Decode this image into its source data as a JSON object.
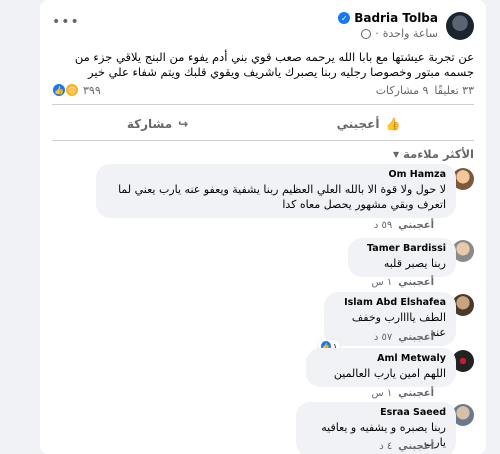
{
  "post": {
    "author": "Badria Tolba",
    "time": "ساعة واحدة",
    "text": "عن تجربة عيشتها مع بابا الله يرحمه صعب قوي بني أدم يفوء من البنج يلاقي جزء من جسمه مبتور وخصوصا رجليه ربنا يصبرك ياشريف ويقوي قلبك ويتم شفاء علي خير",
    "reaction_count": "٣٩٩",
    "comment_count": "٣٣ تعليقًا",
    "share_count": "٩ مشاركات"
  },
  "actions": {
    "like": "أعجبني",
    "share": "مشاركة"
  },
  "sort_label": "الأكثر ملاءمة",
  "comments": [
    {
      "name": "Om Hamza",
      "text": "لا حول ولا قوة الا بالله العلي العظيم ربنا يشفية ويعفو عنه يارب يعني لما اتعرف وبقي مشهور يحصل معاه كدا",
      "like": "أعجبني",
      "time": "٥٩ د"
    },
    {
      "name": "Tamer Bardissi",
      "text": "ربنا يصبر قلبه",
      "like": "أعجبني",
      "time": "١ س"
    },
    {
      "name": "Islam Abd Elshafea",
      "text": "الطف ياااارب وخفف عنه",
      "like": "أعجبني",
      "time": "٥٧ د",
      "reactions": "١"
    },
    {
      "name": "Aml Metwaly",
      "text": "اللهم امين يارب العالمين",
      "like": "أعجبني",
      "time": "١ س"
    },
    {
      "name": "Esraa Saeed",
      "text": "ربنا يصبره و يشفيه و يعافيه يارب",
      "like": "أعجبني",
      "time": "٤ د"
    }
  ],
  "colors": {
    "brand": "#1877f2",
    "muted": "#65676b",
    "bubble": "#f0f2f5"
  },
  "icons": [
    "more-icon",
    "verified-icon",
    "globe-icon",
    "like-reaction-icon",
    "sad-reaction-icon",
    "like-icon",
    "share-icon",
    "caret-down-icon"
  ]
}
